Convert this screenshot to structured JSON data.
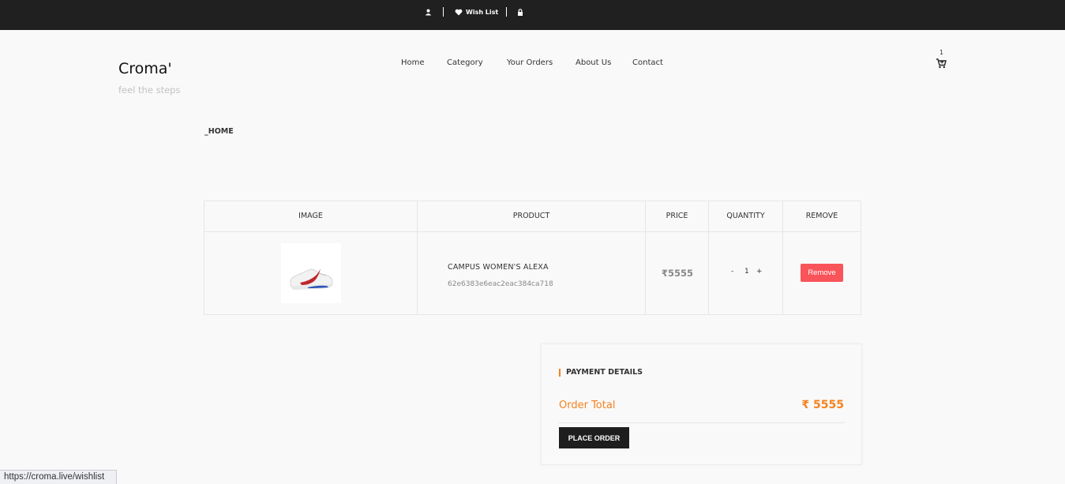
{
  "topbar": {
    "account_icon": "user-icon",
    "wishlist_icon": "heart-icon",
    "wishlist_label": "Wish List",
    "lock_icon": "lock-icon"
  },
  "brand": {
    "name": "Croma'",
    "tagline": "feel the steps"
  },
  "nav": [
    "Home",
    "Category",
    "Your Orders",
    "About Us",
    "Contact"
  ],
  "cart": {
    "count": "1",
    "icon": "cart-icon"
  },
  "breadcrumb": "_HOME",
  "table": {
    "headers": [
      "IMAGE",
      "PRODUCT",
      "PRICE",
      "QUANTITY",
      "REMOVE"
    ],
    "rows": [
      {
        "image": "white-red-sneaker",
        "name": "CAMPUS WOMEN'S ALEXA",
        "id": "62e6383e6eac2eac384ca718",
        "price": "₹5555",
        "qty_minus": "-",
        "qty": "1",
        "qty_plus": "+",
        "remove_label": "Remove"
      }
    ]
  },
  "payment": {
    "title": "PAYMENT DETAILS",
    "order_total_label": "Order Total",
    "order_total_value": "₹ 5555",
    "place_order_label": "PLACE ORDER"
  },
  "status_url": "https://croma.live/wishlist",
  "colors": {
    "accent": "#f58220",
    "remove": "#f9545a",
    "topbar": "#202020"
  }
}
